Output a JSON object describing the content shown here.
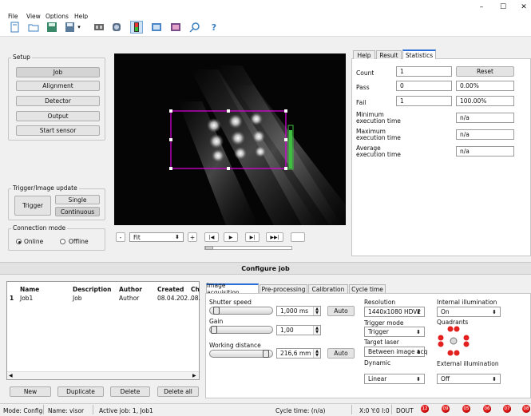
{
  "menu": [
    "File",
    "View",
    "Options",
    "Help"
  ],
  "window_controls": [
    "–",
    "☐",
    "✕"
  ],
  "setup": {
    "title": "Setup",
    "buttons": [
      "Job",
      "Alignment",
      "Detector",
      "Output",
      "Start sensor"
    ]
  },
  "trigger": {
    "title": "Trigger/Image update",
    "trigger_label": "Trigger",
    "single_label": "Single",
    "continuous_label": "Continuous"
  },
  "connection": {
    "title": "Connection mode",
    "online": "Online",
    "offline": "Offline",
    "selected": "Online"
  },
  "viewer": {
    "zoom": "Fit",
    "minus": "-",
    "plus": "+",
    "first": "|◀",
    "play": "▶",
    "next": "▶|",
    "last": "▶▶|"
  },
  "stats": {
    "tabs": [
      "Help",
      "Result",
      "Statistics"
    ],
    "active_tab": "Statistics",
    "count_label": "Count",
    "count_value": "1",
    "reset_label": "Reset",
    "pass_label": "Pass",
    "pass_value": "0",
    "pass_pct": "0.00%",
    "fail_label": "Fail",
    "fail_value": "1",
    "fail_pct": "100.00%",
    "min_label": "Minimum execution time",
    "min_value": "n/a",
    "max_label": "Maximum execution time",
    "max_value": "n/a",
    "avg_label": "Average execution time",
    "avg_value": "n/a"
  },
  "configure": {
    "title": "Configure job"
  },
  "jobs": {
    "headers": [
      "Name",
      "Description",
      "Author",
      "Created",
      "Ch"
    ],
    "rows": [
      {
        "idx": "1",
        "name": "Job1",
        "description": "Job",
        "author": "Author",
        "created": "08.04.202...",
        "ch": "08."
      }
    ],
    "scroll_left": "◀",
    "scroll_right": "▶",
    "buttons": [
      "New",
      "Duplicate",
      "Delete",
      "Delete all"
    ]
  },
  "config_tabs": [
    "Image acquisition",
    "Pre-processing",
    "Calibration",
    "Cycle time"
  ],
  "acquisition": {
    "shutter_label": "Shutter speed",
    "shutter_value": "1,000 ms",
    "shutter_level": 0.05,
    "auto_label": "Auto",
    "gain_label": "Gain",
    "gain_value": "1,00",
    "gain_level": 0.0,
    "wd_label": "Working distance",
    "wd_value": "216,6 mm",
    "wd_level": 0.95,
    "resolution_label": "Resolution",
    "resolution_value": "1440x1080 HDV2",
    "trigger_mode_label": "Trigger mode",
    "trigger_mode_value": "Trigger",
    "target_laser_label": "Target laser",
    "target_laser_value": "Between image acq",
    "dynamic_label": "Dynamic",
    "dynamic_value": "Linear",
    "internal_label": "Internal illumination",
    "internal_value": "On",
    "quadrants_label": "Quadrants",
    "external_label": "External illumination",
    "external_value": "Off"
  },
  "status": {
    "mode": "Mode: Config",
    "name": "Name:  visor",
    "active_job": "Active job:  1, Job1",
    "cycle": "Cycle time:  (n/a)",
    "coords": "X:0 Y:0 I:0",
    "dout": "DOUT",
    "leds": [
      "12",
      "09",
      "05",
      "06",
      "07",
      "08"
    ],
    "led_color": "#e32020"
  },
  "colors": {
    "roi": "#e000e0",
    "signal": "#3fbf3f",
    "accent_tab": "#2a6fd6"
  }
}
